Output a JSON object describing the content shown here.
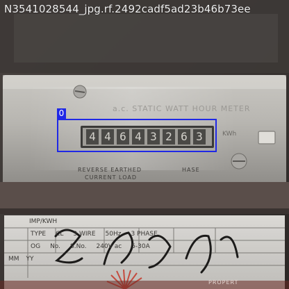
{
  "image": {
    "filename_label": "N3541028544_jpg.rf.2492cadf5ad23b46b73ee"
  },
  "annotation": {
    "class_label": "0",
    "box_color": "#1f28e6"
  },
  "meter": {
    "header_text": "a.c. STATIC WATT HOUR METER",
    "reading_digits": [
      "4",
      "4",
      "6",
      "4",
      "3",
      "2",
      "6",
      "3"
    ],
    "unit_text": "KWh",
    "under_text_1": "REVERSE  EARTHED",
    "under_text_2": "CURRENT  LOAD",
    "side_text": "HASE"
  },
  "label_plate": {
    "row1": [
      "IMP/KWH"
    ],
    "row2": [
      "TYPE",
      "CL",
      "3 WIRE",
      "50Hz",
      "3 PHASE"
    ],
    "row3": [
      "OG",
      "No.",
      "S.No.",
      "240V ac",
      "5-30A"
    ],
    "row4": [
      "MM",
      "YY"
    ],
    "footer_text": "PROPERT"
  }
}
